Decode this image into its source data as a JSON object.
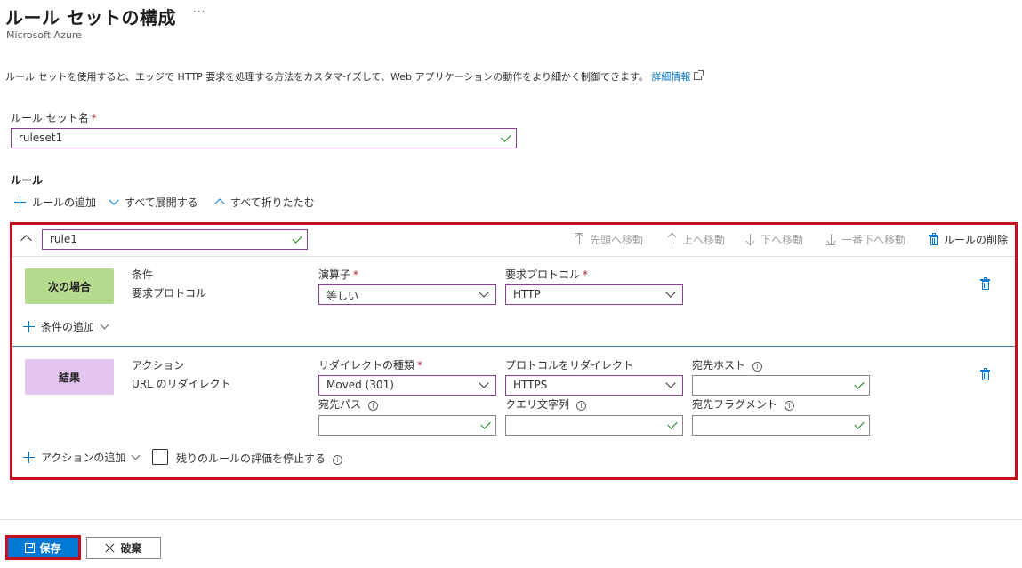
{
  "header": {
    "title": "ルール セットの構成",
    "more_label": "···",
    "subtitle": "Microsoft Azure"
  },
  "description": {
    "text": "ルール セットを使用すると、エッジで HTTP 要求を処理する方法をカスタマイズして、Web アプリケーションの動作をより細かく制御できます。",
    "link": "詳細情報"
  },
  "ruleset": {
    "label": "ルール セット名",
    "required_mark": "*",
    "value": "ruleset1"
  },
  "rules_section": {
    "title": "ルール",
    "add_rule": "ルールの追加",
    "expand_all": "すべて展開する",
    "collapse_all": "すべて折りたたむ"
  },
  "rule": {
    "name": "rule1",
    "actions": {
      "move_top": "先頭へ移動",
      "move_up": "上へ移動",
      "move_down": "下へ移動",
      "move_bottom": "一番下へ移動",
      "delete": "ルールの削除"
    },
    "condition": {
      "badge": "次の場合",
      "type_label": "条件",
      "type_value": "要求プロトコル",
      "operator_label": "演算子",
      "operator_value": "等しい",
      "protocol_label": "要求プロトコル",
      "protocol_value": "HTTP",
      "add_condition": "条件の追加"
    },
    "result": {
      "badge": "結果",
      "type_label": "アクション",
      "type_value": "URL のリダイレクト",
      "redirect_type_label": "リダイレクトの種類",
      "redirect_type_value": "Moved (301)",
      "redirect_protocol_label": "プロトコルをリダイレクト",
      "redirect_protocol_value": "HTTPS",
      "dest_host_label": "宛先ホスト",
      "dest_path_label": "宛先パス",
      "query_string_label": "クエリ文字列",
      "dest_fragment_label": "宛先フラグメント",
      "add_action": "アクションの追加",
      "stop_eval_label": "残りのルールの評価を停止する"
    }
  },
  "footer": {
    "save": "保存",
    "discard": "破棄"
  },
  "colors": {
    "accent": "#0078d4",
    "highlight_border": "#c50f1f",
    "condition_badge": "#b5db8f",
    "result_badge": "#e3c4ef",
    "field_border": "#8a3d99",
    "valid_check": "#107c10"
  }
}
